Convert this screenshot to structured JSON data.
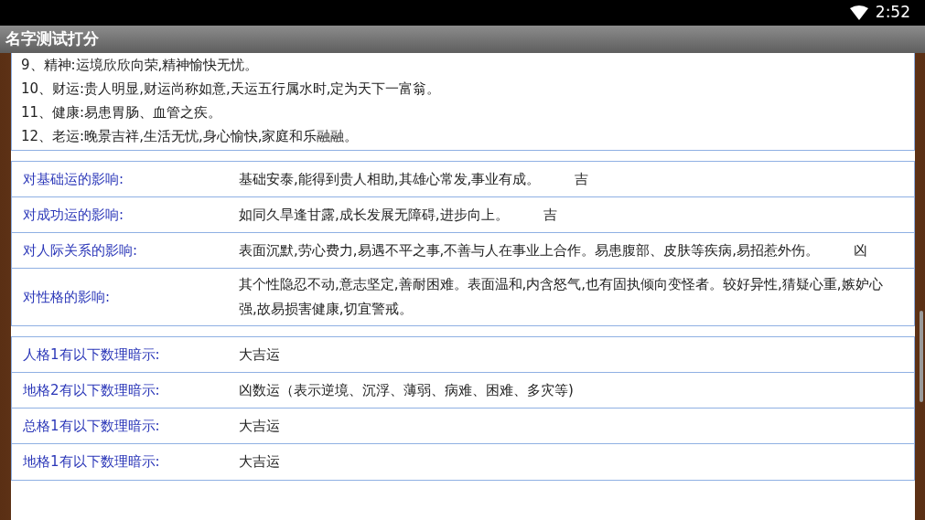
{
  "status_bar": {
    "time": "2:52"
  },
  "app_bar": {
    "title": "名字测试打分"
  },
  "summary_lines": [
    "9、精神:运境欣欣向荣,精神愉快无忧。",
    "10、财运:贵人明显,财运尚称如意,天运五行属水时,定为天下一富翁。",
    "11、健康:易患胃肠、血管之疾。",
    "12、老运:晚景吉祥,生活无忧,身心愉快,家庭和乐融融。"
  ],
  "influence_table": [
    {
      "label": "对基础运的影响:",
      "text": "基础安泰,能得到贵人相助,其雄心常发,事业有成。",
      "verdict": "吉"
    },
    {
      "label": "对成功运的影响:",
      "text": "如同久旱逢甘露,成长发展无障碍,进步向上。",
      "verdict": "吉"
    },
    {
      "label": "对人际关系的影响:",
      "text": "表面沉默,劳心费力,易遇不平之事,不善与人在事业上合作。易患腹部、皮肤等疾病,易招惹外伤。",
      "verdict": "凶"
    },
    {
      "label": "对性格的影响:",
      "text": "其个性隐忍不动,意志坚定,善耐困难。表面温和,内含怒气,也有固执倾向变怪者。较好异性,猜疑心重,嫉妒心强,故易损害健康,切宜警戒。"
    }
  ],
  "number_table": [
    {
      "label": "人格1有以下数理暗示:",
      "text": "大吉运"
    },
    {
      "label": "地格2有以下数理暗示:",
      "text": "凶数运（表示逆境、沉浮、薄弱、病难、困难、多灾等)"
    },
    {
      "label": "总格1有以下数理暗示:",
      "text": "大吉运"
    },
    {
      "label": "地格1有以下数理暗示:",
      "text": "大吉运"
    }
  ]
}
